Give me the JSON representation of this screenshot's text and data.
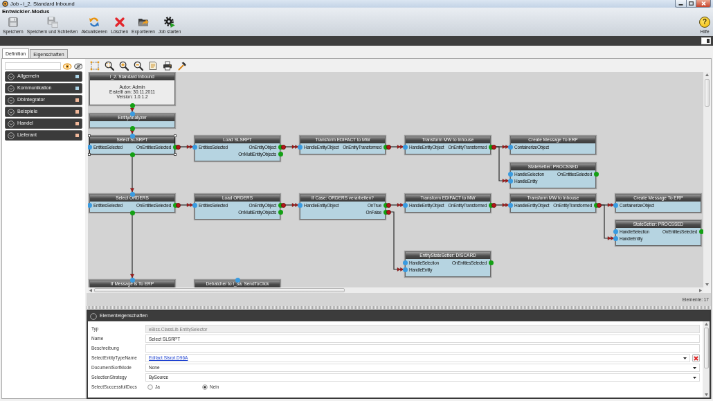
{
  "window": {
    "title": "Job - i_2. Standard Inbound"
  },
  "mode_title": "Entwickler-Modus",
  "toolbar": [
    {
      "label": "Speichern",
      "disabled": true
    },
    {
      "label": "Speichern und Schließen",
      "disabled": true
    },
    {
      "label": "Aktualisieren",
      "disabled": false
    },
    {
      "label": "Löschen",
      "disabled": false
    },
    {
      "label": "Exportieren",
      "disabled": false
    },
    {
      "label": "Job starten",
      "disabled": false
    }
  ],
  "help_button": {
    "icon_text": "?",
    "label": "Hilfe"
  },
  "tabs": [
    {
      "label": "Definition",
      "selected": true
    },
    {
      "label": "Eigenschaften",
      "selected": false
    }
  ],
  "toolbox": {
    "categories": [
      {
        "label": "Allgemein",
        "color": "#a9d3e6",
        "expanded": false
      },
      {
        "label": "Kommunikation",
        "color": "#a9d3e6",
        "expanded": false
      },
      {
        "label": "DbIntegrator",
        "color": "#f2b89a",
        "expanded": false
      },
      {
        "label": "Beispiele",
        "color": "#f2b89a",
        "expanded": false
      },
      {
        "label": "Handel",
        "color": "#f2b89a",
        "expanded": false
      },
      {
        "label": "Lieferant",
        "color": "#f2b89a",
        "expanded": false
      }
    ]
  },
  "diagram": {
    "nodes": [
      {
        "kind": "info",
        "title": "i_2. Standard Inbound",
        "lines": [
          "Autor: Admin",
          "Erstellt am: 30.11.2011",
          "Version: 1.0.1.2"
        ],
        "selected": false,
        "top_port": false,
        "bottom_port": true
      },
      {
        "kind": "step",
        "title": "EntityAnalyzer",
        "selected": false,
        "top_port": true,
        "bottom_port": true
      },
      {
        "kind": "step",
        "title": "Select SLSRPT",
        "selected": true,
        "top_port": true,
        "bottom_port": true,
        "inputs": [
          {
            "label": "EntitiesSelected"
          }
        ],
        "outputs": [
          {
            "label": "OnEntitiesSelected",
            "connected": true
          }
        ]
      },
      {
        "kind": "step",
        "title": "Load SLSRPT",
        "selected": false,
        "top_port": false,
        "bottom_port": false,
        "inputs": [
          {
            "label": "EntitiesSelected"
          }
        ],
        "outputs": [
          {
            "label": "OnEntityObject",
            "connected": true
          },
          {
            "label": "OnMultiEntityObjects",
            "connected": false
          }
        ]
      },
      {
        "kind": "step",
        "title": "Transform EDIFACT to MW",
        "selected": false,
        "top_port": false,
        "bottom_port": false,
        "inputs": [
          {
            "label": "HandleEntityObject"
          }
        ],
        "outputs": [
          {
            "label": "OnEntityTransformed",
            "connected": true
          }
        ]
      },
      {
        "kind": "step",
        "title": "Transform MW to Inhouse",
        "selected": false,
        "top_port": false,
        "bottom_port": false,
        "inputs": [
          {
            "label": "HandleEntityObject"
          }
        ],
        "outputs": [
          {
            "label": "OnEntityTransformed",
            "connected": true
          }
        ]
      },
      {
        "kind": "step",
        "title": "Create Message To ERP",
        "selected": false,
        "top_port": false,
        "bottom_port": false,
        "inputs": [
          {
            "label": "ContainerizeObject"
          }
        ]
      },
      {
        "kind": "step",
        "title": "StateSetter: PROCSSED",
        "selected": false,
        "top_port": false,
        "bottom_port": false,
        "inputs": [
          {
            "label": "HandleSelection"
          },
          {
            "label": "HandleEntity"
          }
        ],
        "outputs": [
          {
            "label": "OnEntitiesSelected",
            "connected": false
          }
        ]
      },
      {
        "kind": "step",
        "title": "Select ORDERS",
        "selected": false,
        "top_port": true,
        "bottom_port": true,
        "inputs": [
          {
            "label": "EntitiesSelected"
          }
        ],
        "outputs": [
          {
            "label": "OnEntitiesSelected",
            "connected": true
          }
        ]
      },
      {
        "kind": "step",
        "title": "Load ORDERS",
        "selected": false,
        "top_port": false,
        "bottom_port": false,
        "inputs": [
          {
            "label": "EntitiesSelected"
          }
        ],
        "outputs": [
          {
            "label": "OnEntityObject",
            "connected": true
          },
          {
            "label": "OnMultiEntityObjects",
            "connected": false
          }
        ]
      },
      {
        "kind": "step",
        "title": "If Case: ORDERS verarbeiten?",
        "selected": false,
        "top_port": false,
        "bottom_port": false,
        "inputs": [
          {
            "label": "HandleEntityObject"
          }
        ],
        "outputs": [
          {
            "label": "OnTrue",
            "connected": true
          },
          {
            "label": "OnFalse",
            "connected": true
          }
        ]
      },
      {
        "kind": "step",
        "title": "Transform EDIFACT to MW",
        "selected": false,
        "top_port": false,
        "bottom_port": false,
        "inputs": [
          {
            "label": "HandleEntityObject"
          }
        ],
        "outputs": [
          {
            "label": "OnEntityTransformed",
            "connected": true
          }
        ]
      },
      {
        "kind": "step",
        "title": "Transform MW to Inhouse",
        "selected": false,
        "top_port": false,
        "bottom_port": false,
        "inputs": [
          {
            "label": "HandleEntityObject"
          }
        ],
        "outputs": [
          {
            "label": "OnEntityTransformed",
            "connected": true
          }
        ]
      },
      {
        "kind": "step",
        "title": "Create Message To ERP",
        "selected": false,
        "top_port": false,
        "bottom_port": false,
        "inputs": [
          {
            "label": "ContainerizeObject"
          }
        ]
      },
      {
        "kind": "step",
        "title": "StateSetter: PROCSSED",
        "selected": false,
        "top_port": false,
        "bottom_port": false,
        "inputs": [
          {
            "label": "HandleSelection"
          },
          {
            "label": "HandleEntity"
          }
        ],
        "outputs": [
          {
            "label": "OnEntitiesSelected",
            "connected": false
          }
        ]
      },
      {
        "kind": "step",
        "title": "EntityStateSetter: DISCARD",
        "selected": false,
        "top_port": false,
        "bottom_port": false,
        "inputs": [
          {
            "label": "HandleSelection"
          },
          {
            "label": "HandleEntity"
          }
        ],
        "outputs": [
          {
            "label": "OnEntitiesSelected",
            "connected": false
          }
        ]
      },
      {
        "kind": "step",
        "title": "If Message is To ERP",
        "selected": false,
        "top_port": true,
        "bottom_port": false
      },
      {
        "kind": "step",
        "title": "Debatcher to i_3a. SendToClick",
        "selected": false,
        "top_port": true,
        "bottom_port": false
      }
    ]
  },
  "status_bar": {
    "element_count": "Elemente: 17"
  },
  "properties": {
    "title": "Elementeigenschaften",
    "rows": [
      {
        "kind": "text",
        "label": "Typ",
        "value": "eBiss.ClassLib.EntitySelector",
        "disabled": true
      },
      {
        "kind": "text",
        "label": "Name",
        "value": "Select SLSRPT",
        "disabled": false
      },
      {
        "kind": "text",
        "label": "Beschreibung",
        "disabled": false
      },
      {
        "kind": "link",
        "label": "SelectEntityTypeName",
        "value": "Edifact.Slsrpt.D96A"
      },
      {
        "kind": "select",
        "label": "DocumentSortMode",
        "value": "None"
      },
      {
        "kind": "select",
        "label": "SelectionStrategy",
        "value": "BySource"
      },
      {
        "kind": "radio",
        "label": "SelectSuccessfullDocs",
        "options": [
          {
            "label": "Ja",
            "selected": false
          },
          {
            "label": "Nein",
            "selected": true
          }
        ]
      }
    ]
  }
}
